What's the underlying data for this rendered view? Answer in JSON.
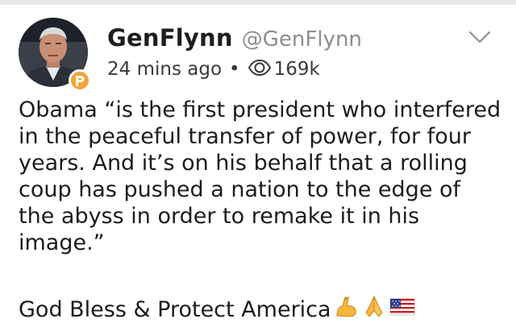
{
  "post": {
    "author_name": "GenFlynn",
    "author_handle": "@GenFlynn",
    "time_ago": "24 mins ago",
    "separator": "•",
    "view_count": "169k",
    "body": "Obama “is the first president who interfered in the peaceful transfer of power, for four years. And it’s on his behalf that a rolling coup has pushed a nation to the edge of the abyss in order to remake it in his image.”",
    "signoff": "God Bless & Protect America"
  },
  "icons": {
    "badge": "parler-badge-icon",
    "views": "eye-icon",
    "menu": "chevron-down-icon",
    "emojis": [
      "flexed-biceps-emoji",
      "folded-hands-emoji",
      "us-flag-emoji"
    ]
  },
  "colors": {
    "badge": "#f2a33a",
    "handle": "#8d8d8d",
    "text": "#1c1c1c"
  }
}
